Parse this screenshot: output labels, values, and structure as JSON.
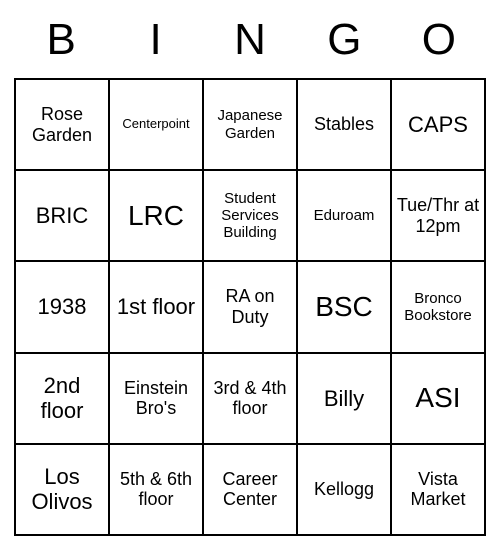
{
  "header": {
    "letters": [
      "B",
      "I",
      "N",
      "G",
      "O"
    ]
  },
  "grid": {
    "cells": [
      [
        {
          "text": "Rose Garden",
          "size": "md"
        },
        {
          "text": "Centerpoint",
          "size": "xs"
        },
        {
          "text": "Japanese Garden",
          "size": "sm"
        },
        {
          "text": "Stables",
          "size": "md"
        },
        {
          "text": "CAPS",
          "size": "lg"
        }
      ],
      [
        {
          "text": "BRIC",
          "size": "lg"
        },
        {
          "text": "LRC",
          "size": "xl"
        },
        {
          "text": "Student Services Building",
          "size": "sm"
        },
        {
          "text": "Eduroam",
          "size": "sm"
        },
        {
          "text": "Tue/Thr at 12pm",
          "size": "md"
        }
      ],
      [
        {
          "text": "1938",
          "size": "lg"
        },
        {
          "text": "1st floor",
          "size": "lg"
        },
        {
          "text": "RA on Duty",
          "size": "md"
        },
        {
          "text": "BSC",
          "size": "xl"
        },
        {
          "text": "Bronco Bookstore",
          "size": "sm"
        }
      ],
      [
        {
          "text": "2nd floor",
          "size": "lg"
        },
        {
          "text": "Einstein Bro's",
          "size": "md"
        },
        {
          "text": "3rd & 4th floor",
          "size": "md"
        },
        {
          "text": "Billy",
          "size": "lg"
        },
        {
          "text": "ASI",
          "size": "xl"
        }
      ],
      [
        {
          "text": "Los Olivos",
          "size": "lg"
        },
        {
          "text": "5th & 6th floor",
          "size": "md"
        },
        {
          "text": "Career Center",
          "size": "md"
        },
        {
          "text": "Kellogg",
          "size": "md"
        },
        {
          "text": "Vista Market",
          "size": "md"
        }
      ]
    ]
  }
}
